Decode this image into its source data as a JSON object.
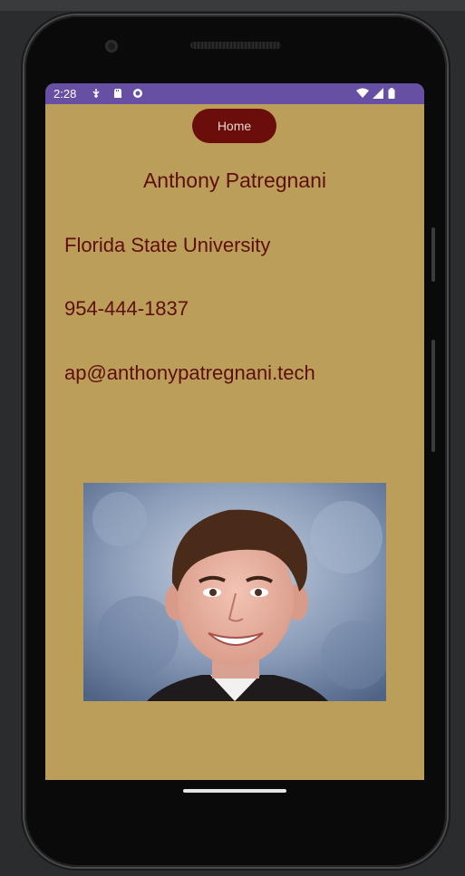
{
  "status_bar": {
    "time": "2:28",
    "left_icons": [
      "usb-debug-icon",
      "sd-card-icon",
      "notification-icon"
    ],
    "right_icons": [
      "wifi-icon",
      "signal-icon",
      "battery-icon"
    ],
    "color": "#6750a4"
  },
  "app": {
    "home_button_label": "Home",
    "name": "Anthony Patregnani",
    "school": "Florida State University",
    "phone": "954-444-1837",
    "email": "ap@anthonypatregnani.tech",
    "background_color": "#bc9e5b",
    "text_color": "#5e0f0c",
    "button_color": "#6b0d0a",
    "photo_description": "portrait-photo"
  }
}
